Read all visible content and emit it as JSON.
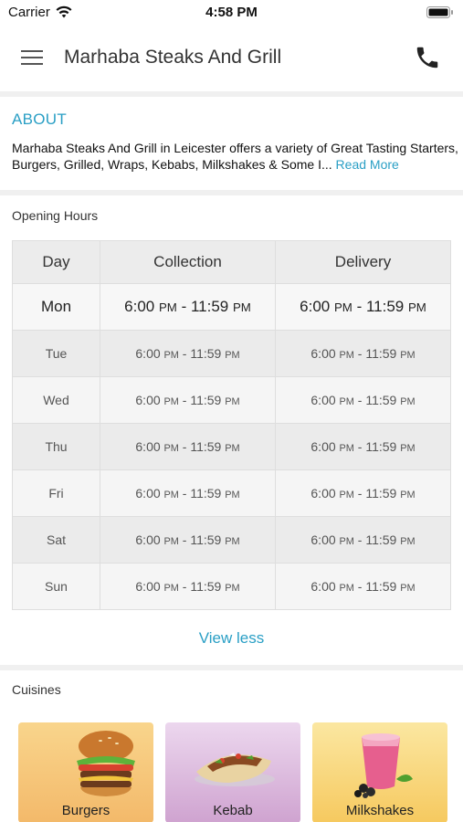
{
  "status_bar": {
    "carrier": "Carrier",
    "time": "4:58 PM"
  },
  "header": {
    "title": "Marhaba Steaks And Grill",
    "menu_icon": "hamburger-menu-icon",
    "call_icon": "phone-icon"
  },
  "about": {
    "heading": "ABOUT",
    "text": "Marhaba Steaks And Grill in Leicester offers a variety of Great Tasting Starters, Burgers, Grilled, Wraps, Kebabs, Milkshakes & Some I...",
    "read_more": "Read More"
  },
  "opening_hours": {
    "label": "Opening Hours",
    "columns": [
      "Day",
      "Collection",
      "Delivery"
    ],
    "rows": [
      {
        "day": "Mon",
        "collection_start": "6:00",
        "collection_start_ampm": "PM",
        "collection_end": "11:59",
        "collection_end_ampm": "PM",
        "delivery_start": "6:00",
        "delivery_start_ampm": "PM",
        "delivery_end": "11:59",
        "delivery_end_ampm": "PM"
      },
      {
        "day": "Tue",
        "collection_start": "6:00",
        "collection_start_ampm": "PM",
        "collection_end": "11:59",
        "collection_end_ampm": "PM",
        "delivery_start": "6:00",
        "delivery_start_ampm": "PM",
        "delivery_end": "11:59",
        "delivery_end_ampm": "PM"
      },
      {
        "day": "Wed",
        "collection_start": "6:00",
        "collection_start_ampm": "PM",
        "collection_end": "11:59",
        "collection_end_ampm": "PM",
        "delivery_start": "6:00",
        "delivery_start_ampm": "PM",
        "delivery_end": "11:59",
        "delivery_end_ampm": "PM"
      },
      {
        "day": "Thu",
        "collection_start": "6:00",
        "collection_start_ampm": "PM",
        "collection_end": "11:59",
        "collection_end_ampm": "PM",
        "delivery_start": "6:00",
        "delivery_start_ampm": "PM",
        "delivery_end": "11:59",
        "delivery_end_ampm": "PM"
      },
      {
        "day": "Fri",
        "collection_start": "6:00",
        "collection_start_ampm": "PM",
        "collection_end": "11:59",
        "collection_end_ampm": "PM",
        "delivery_start": "6:00",
        "delivery_start_ampm": "PM",
        "delivery_end": "11:59",
        "delivery_end_ampm": "PM"
      },
      {
        "day": "Sat",
        "collection_start": "6:00",
        "collection_start_ampm": "PM",
        "collection_end": "11:59",
        "collection_end_ampm": "PM",
        "delivery_start": "6:00",
        "delivery_start_ampm": "PM",
        "delivery_end": "11:59",
        "delivery_end_ampm": "PM"
      },
      {
        "day": "Sun",
        "collection_start": "6:00",
        "collection_start_ampm": "PM",
        "collection_end": "11:59",
        "collection_end_ampm": "PM",
        "delivery_start": "6:00",
        "delivery_start_ampm": "PM",
        "delivery_end": "11:59",
        "delivery_end_ampm": "PM"
      }
    ],
    "view_less": "View less"
  },
  "cuisines": {
    "label": "Cuisines",
    "items": [
      {
        "name": "Burgers",
        "icon": "burger-icon"
      },
      {
        "name": "Kebab",
        "icon": "kebab-icon"
      },
      {
        "name": "Milkshakes",
        "icon": "milkshake-icon"
      }
    ]
  },
  "colors": {
    "accent": "#2a9fc5"
  }
}
